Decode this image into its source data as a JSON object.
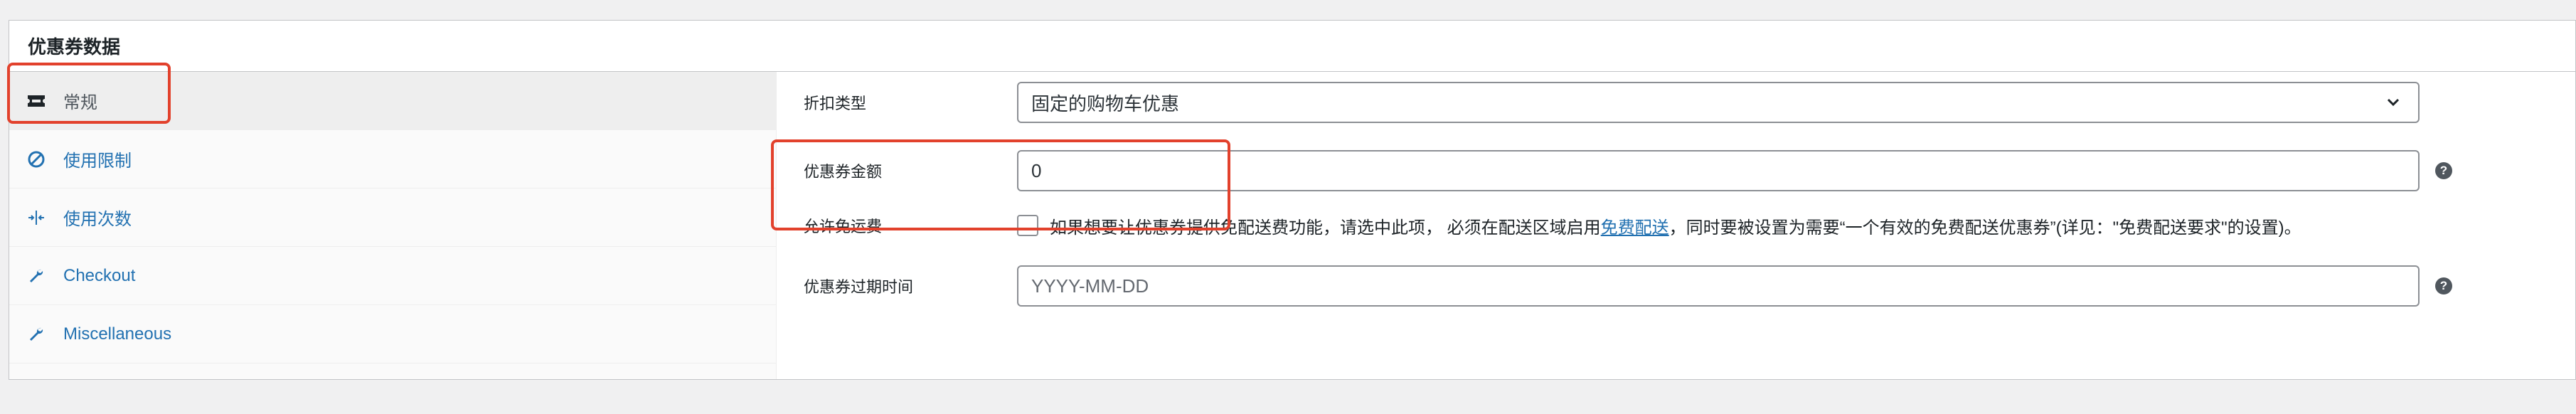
{
  "panel": {
    "title": "优惠券数据"
  },
  "tabs": [
    {
      "label": "常规",
      "icon": "ticket-icon",
      "active": true
    },
    {
      "label": "使用限制",
      "icon": "ban-icon",
      "active": false
    },
    {
      "label": "使用次数",
      "icon": "split-icon",
      "active": false
    },
    {
      "label": "Checkout",
      "icon": "wrench-icon",
      "active": false
    },
    {
      "label": "Miscellaneous",
      "icon": "wrench-icon",
      "active": false
    }
  ],
  "fields": {
    "discount_type": {
      "label": "折扣类型",
      "value": "固定的购物车优惠"
    },
    "amount": {
      "label": "优惠券金额",
      "value": "0"
    },
    "free_shipping": {
      "label": "允许免运费",
      "checked": false,
      "desc_before": "如果想要让优惠券提供免配送费功能，请选中此项， 必须在配送区域启用",
      "desc_link": "免费配送",
      "desc_after": "，同时要被设置为需要“一个有效的免费配送优惠券”(详见：\"免费配送要求\"的设置)。"
    },
    "expiry": {
      "label": "优惠券过期时间",
      "placeholder": "YYYY-MM-DD"
    }
  },
  "help_icon": "?",
  "colors": {
    "link": "#2271b1",
    "highlight": "#e2412c"
  }
}
